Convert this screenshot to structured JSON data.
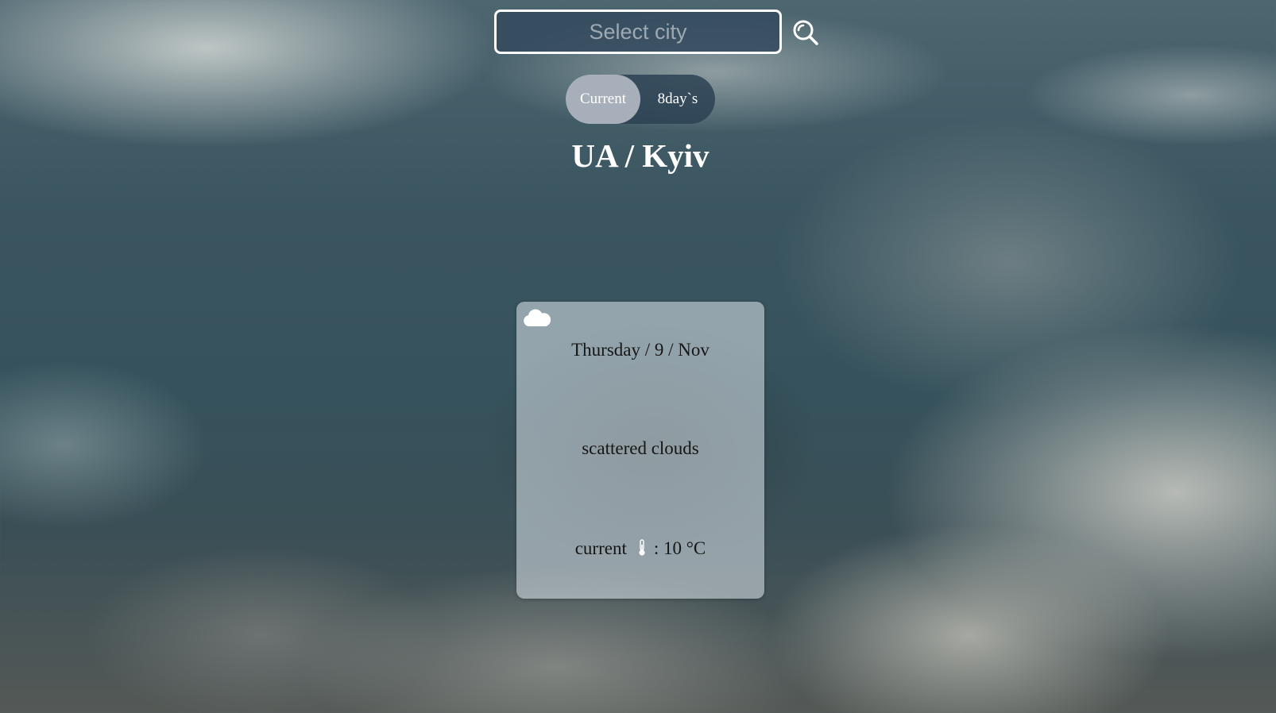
{
  "search": {
    "placeholder": "Select city",
    "value": "",
    "button_icon": "search-icon"
  },
  "tabs": [
    {
      "label": "Current",
      "active": true
    },
    {
      "label": "8day`s",
      "active": false
    }
  ],
  "location": {
    "title": "UA / Kyiv"
  },
  "weather_card": {
    "icon": "cloud-icon",
    "date": "Thursday / 9 / Nov",
    "description": "scattered clouds",
    "temp_prefix": "current",
    "temp_icon": "thermometer-icon",
    "temp_value": ": 10 °C"
  },
  "colors": {
    "input_bg": "#344a5e",
    "input_border": "#ffffff",
    "tab_bar_bg": "#2c4254",
    "tab_active_bg": "#a7b0ba",
    "title_color": "#ffffff",
    "card_bg": "#d6dee6",
    "card_text": "#161616"
  }
}
